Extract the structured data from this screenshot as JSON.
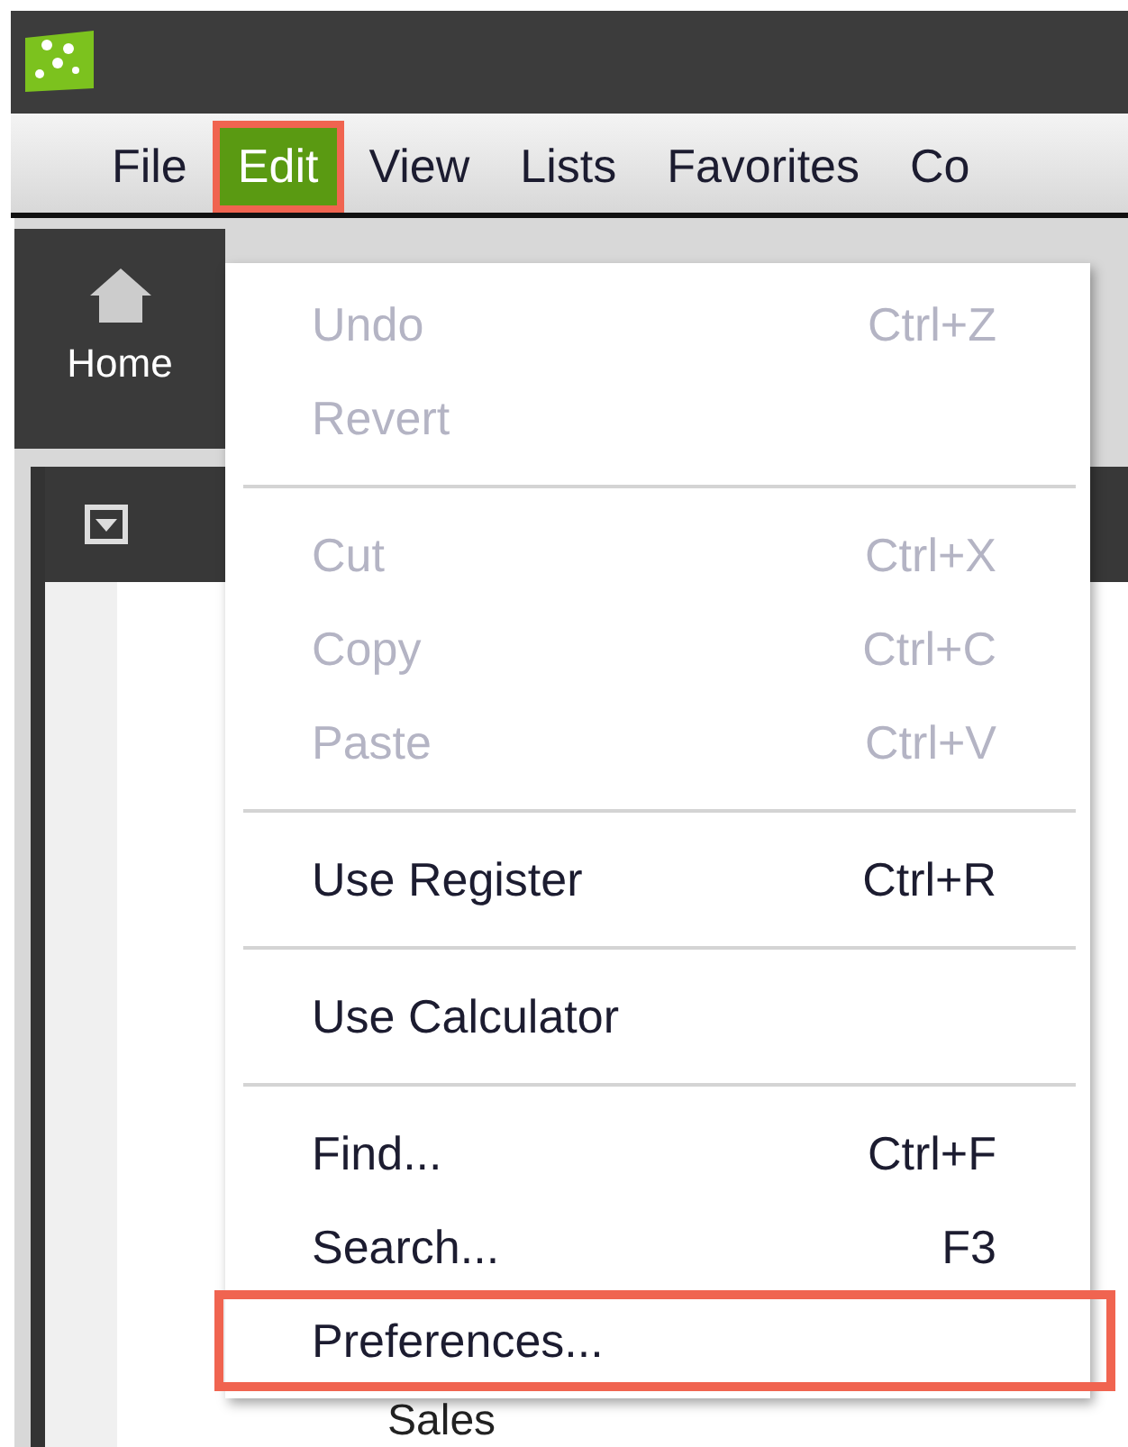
{
  "menu_bar": [
    {
      "label": "File",
      "selected": false,
      "annotated": false
    },
    {
      "label": "Edit",
      "selected": true,
      "annotated": true
    },
    {
      "label": "View",
      "selected": false,
      "annotated": false
    },
    {
      "label": "Lists",
      "selected": false,
      "annotated": false
    },
    {
      "label": "Favorites",
      "selected": false,
      "annotated": false
    },
    {
      "label": "Co",
      "selected": false,
      "annotated": false
    }
  ],
  "toolbar": [
    {
      "label": "Home"
    }
  ],
  "panel": {
    "items": [
      "Sales"
    ]
  },
  "edit_menu": [
    {
      "kind": "item",
      "label": "Undo",
      "shortcut": "Ctrl+Z",
      "disabled": true,
      "annotated": false
    },
    {
      "kind": "item",
      "label": "Revert",
      "disabled": true,
      "annotated": false
    },
    {
      "kind": "separator"
    },
    {
      "kind": "item",
      "label": "Cut",
      "shortcut": "Ctrl+X",
      "disabled": true,
      "annotated": false
    },
    {
      "kind": "item",
      "label": "Copy",
      "shortcut": "Ctrl+C",
      "disabled": true,
      "annotated": false
    },
    {
      "kind": "item",
      "label": "Paste",
      "shortcut": "Ctrl+V",
      "disabled": true,
      "annotated": false
    },
    {
      "kind": "separator"
    },
    {
      "kind": "item",
      "label": "Use Register",
      "shortcut": "Ctrl+R",
      "disabled": false,
      "annotated": false
    },
    {
      "kind": "separator"
    },
    {
      "kind": "item",
      "label": "Use Calculator",
      "disabled": false,
      "annotated": false
    },
    {
      "kind": "separator"
    },
    {
      "kind": "item",
      "label": "Find...",
      "shortcut": "Ctrl+F",
      "disabled": false,
      "annotated": false
    },
    {
      "kind": "item",
      "label": "Search...",
      "shortcut": "F3",
      "disabled": false,
      "annotated": false
    },
    {
      "kind": "item",
      "label": "Preferences...",
      "disabled": false,
      "annotated": true
    }
  ]
}
